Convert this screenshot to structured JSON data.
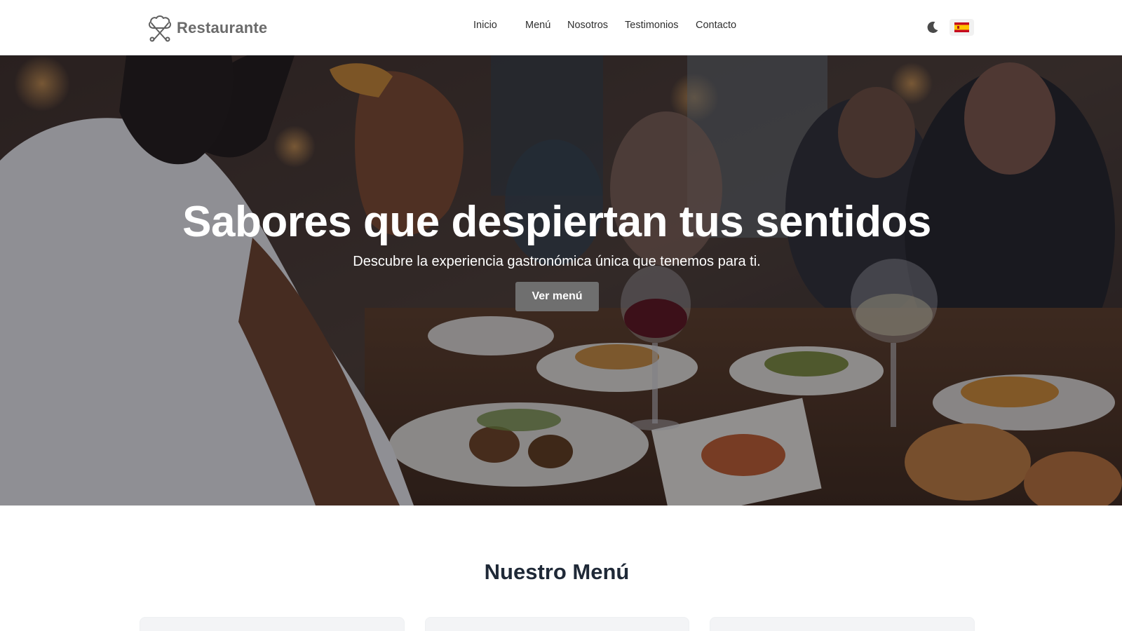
{
  "brand": {
    "name": "Restaurante",
    "logo_icon": "chef-hat-utensils-icon"
  },
  "nav": {
    "links": [
      "Inicio",
      "Menú",
      "Nosotros",
      "Testimonios",
      "Contacto"
    ]
  },
  "controls": {
    "theme_icon": "moon-icon",
    "language_icon": "spain-flag-icon"
  },
  "hero": {
    "title": "Sabores que despiertan tus sentidos",
    "subtitle": "Descubre la experiencia gastronómica única que tenemos para ti.",
    "cta_label": "Ver menú"
  },
  "menu_section": {
    "title": "Nuestro Menú"
  },
  "colors": {
    "brand_text": "#6b6b6b",
    "cta_background": "#6f6f6f",
    "heading": "#1f2937",
    "card_background": "#f3f4f6"
  }
}
